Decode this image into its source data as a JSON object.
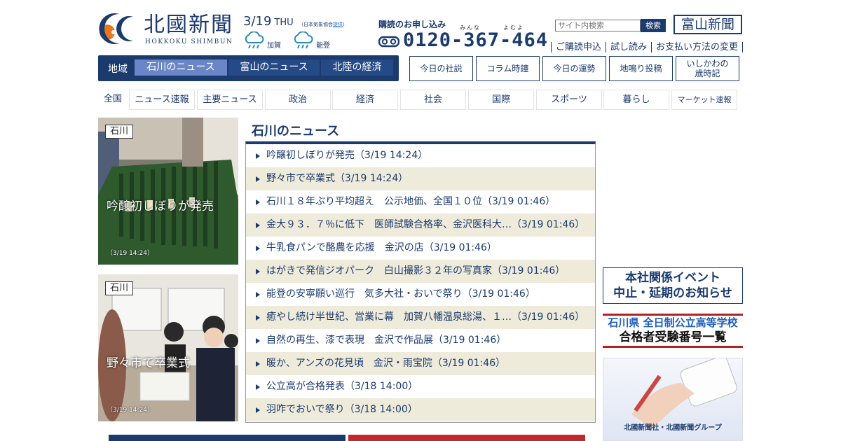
{
  "header": {
    "logo_text": "北國新聞",
    "logo_sub": "HOKKOKU SHIMBUN",
    "date": "3/19",
    "weekday": "THU",
    "weather_source_prefix": "（日本気象協会",
    "weather_source_link": "提供",
    "weather_source_suffix": "）",
    "weather": [
      {
        "area": "加賀",
        "icon": "rain-cloud-icon"
      },
      {
        "area": "能登",
        "icon": "rain-cloud-icon"
      }
    ],
    "subscribe_label": "購読のお申し込み",
    "ruby_minna": "みんな",
    "ruby_yomuyo": "よむよ",
    "phone": "0120-367-464",
    "search_placeholder": "サイト内検索",
    "search_button": "検索",
    "toyama_button": "富山新聞",
    "sub_links": [
      "ご購読申込",
      "試し読み",
      "お支払い方法の変更"
    ]
  },
  "region_nav": {
    "label": "地域",
    "tabs": [
      {
        "label": "石川のニュース",
        "active": true
      },
      {
        "label": "富山のニュース",
        "active": false
      },
      {
        "label": "北陸の経済",
        "active": false
      }
    ]
  },
  "side_buttons": [
    "今日の社説",
    "コラム時鐘",
    "今日の運勢",
    "地鳴り投稿",
    "いしかわの",
    "歳時記"
  ],
  "categories": {
    "all": "全国",
    "items": [
      "ニュース速報",
      "主要ニュース",
      "政治",
      "経済",
      "社会",
      "国際",
      "スポーツ",
      "暮らし",
      "マーケット速報"
    ]
  },
  "photos": [
    {
      "tag": "石川",
      "caption": "吟醸初しぼりが発売",
      "timestamp": "（3/19 14:24）"
    },
    {
      "tag": "石川",
      "caption": "野々市で卒業式",
      "timestamp": "（3/19 14:24）"
    }
  ],
  "news": {
    "title": "石川のニュース",
    "items": [
      "吟醸初しぼりが発売（3/19 14:24）",
      "野々市で卒業式（3/19 14:24）",
      "石川１８年ぶり平均超え　公示地価、全国１０位（3/19 01:46）",
      "金大９３．７％に低下　医師試験合格率、金沢医科大…（3/19 01:46）",
      "牛乳食パンで酪農を応援　金沢の店（3/19 01:46）",
      "はがきで発信ジオパーク　白山撮影３２年の写真家（3/19 01:46）",
      "能登の安寧願い巡行　気多大社・おいで祭り（3/19 01:46）",
      "癒やし続け半世紀、営業に幕　加賀八幡温泉総湯、１…（3/19 01:46）",
      "自然の再生、漆で表現　金沢で作品展（3/19 01:46）",
      "暖か、アンズの花見頃　金沢・雨宝院（3/19 01:46）",
      "公立高が合格発表（3/18 14:00）",
      "羽咋でおいで祭り（3/18 14:00）"
    ]
  },
  "banners": {
    "event_line1": "本社関係イベント",
    "event_line2": "中止・延期のお知らせ",
    "exam_line1": "石川県 全日制公立高等学校",
    "exam_line2": "合格者受験番号一覧",
    "ad_group": "北國新聞社・北國新聞グループ"
  },
  "colors": {
    "brand": "#1b3a6e",
    "active_tab": "#6b86c7",
    "alt_row": "#eeebdb",
    "accent_red": "#b22222"
  }
}
